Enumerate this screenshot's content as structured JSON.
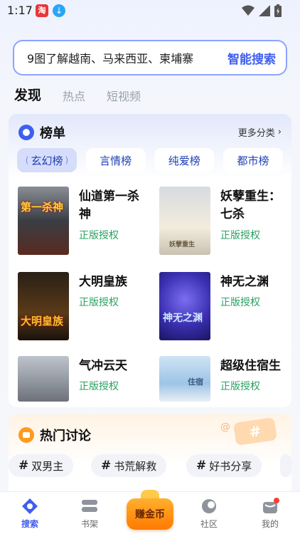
{
  "status": {
    "time": "1:17",
    "app1": "淘"
  },
  "search": {
    "query": "9图了解越南、马来西亚、柬埔寨",
    "button": "智能搜索"
  },
  "tabs": [
    {
      "label": "发现",
      "active": true
    },
    {
      "label": "热点",
      "active": false
    },
    {
      "label": "短视频",
      "active": false
    }
  ],
  "ranking": {
    "title": "榜单",
    "more": "更多分类",
    "categories": [
      "玄幻榜",
      "言情榜",
      "纯爱榜",
      "都市榜"
    ],
    "active_category": "玄幻榜",
    "books": [
      {
        "title": "仙道第一杀神",
        "badge": "正版授权",
        "cover_text": "第一杀神"
      },
      {
        "title": "妖孽重生：七杀",
        "badge": "正版授权",
        "cover_text": "妖孽重生"
      },
      {
        "title": "大明皇族",
        "badge": "正版授权",
        "cover_text": "大明皇族"
      },
      {
        "title": "神无之渊",
        "badge": "正版授权",
        "cover_text": "神无之渊"
      },
      {
        "title": "气冲云天",
        "badge": "正版授权",
        "cover_text": ""
      },
      {
        "title": "超级住宿生",
        "badge": "正版授权",
        "cover_text": "住宿"
      }
    ]
  },
  "hot": {
    "title": "热门讨论",
    "topics": [
      "双男主",
      "书荒解救",
      "好书分享"
    ]
  },
  "bottom_nav": {
    "search": "搜索",
    "shelf": "书架",
    "earn": "赚金币",
    "community": "社区",
    "mine": "我的"
  },
  "colors": {
    "accent": "#3f5ef0",
    "badge_green": "#2aa163",
    "earn_orange": "#ff8a00"
  }
}
